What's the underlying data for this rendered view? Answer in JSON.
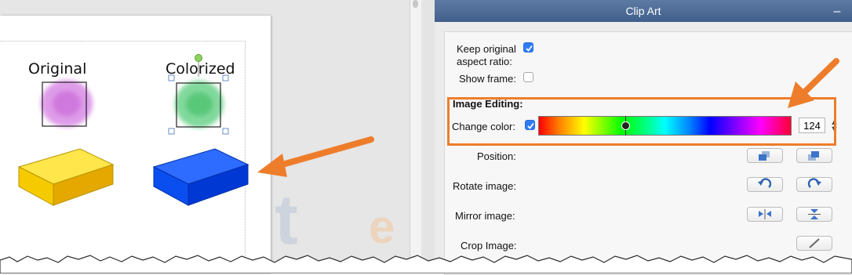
{
  "canvas": {
    "original_caption": "Original",
    "colorized_caption": "Colorized",
    "watermark_text": "t",
    "watermark_text2": "e"
  },
  "panel": {
    "title": "Clip Art",
    "minimize_glyph": "–",
    "keep_aspect_label_1": "Keep original",
    "keep_aspect_label_2": "aspect ratio:",
    "keep_aspect_checked": true,
    "show_frame_label": "Show frame:",
    "show_frame_checked": false,
    "image_editing_heading": "Image Editing:",
    "change_color_label": "Change color:",
    "change_color_checked": true,
    "change_color_value": "124",
    "position_label": "Position:",
    "rotate_label": "Rotate image:",
    "mirror_label": "Mirror image:",
    "crop_label": "Crop Image:"
  },
  "icons": {
    "position_back": "bring-backward-icon",
    "position_front": "bring-forward-icon",
    "rotate_left": "rotate-left-icon",
    "rotate_right": "rotate-right-icon",
    "mirror_horizontal": "mirror-horizontal-icon",
    "mirror_vertical": "mirror-vertical-icon",
    "crop": "crop-icon"
  },
  "colors": {
    "accent": "#2f7cf6",
    "title_bar": "#4a6894",
    "annotation_orange": "#ee7d2b",
    "original_blob": "#d98be6",
    "colorized_blob": "#6cd38b",
    "yellow_block": "#f2c600",
    "blue_block": "#0a4ef0"
  }
}
